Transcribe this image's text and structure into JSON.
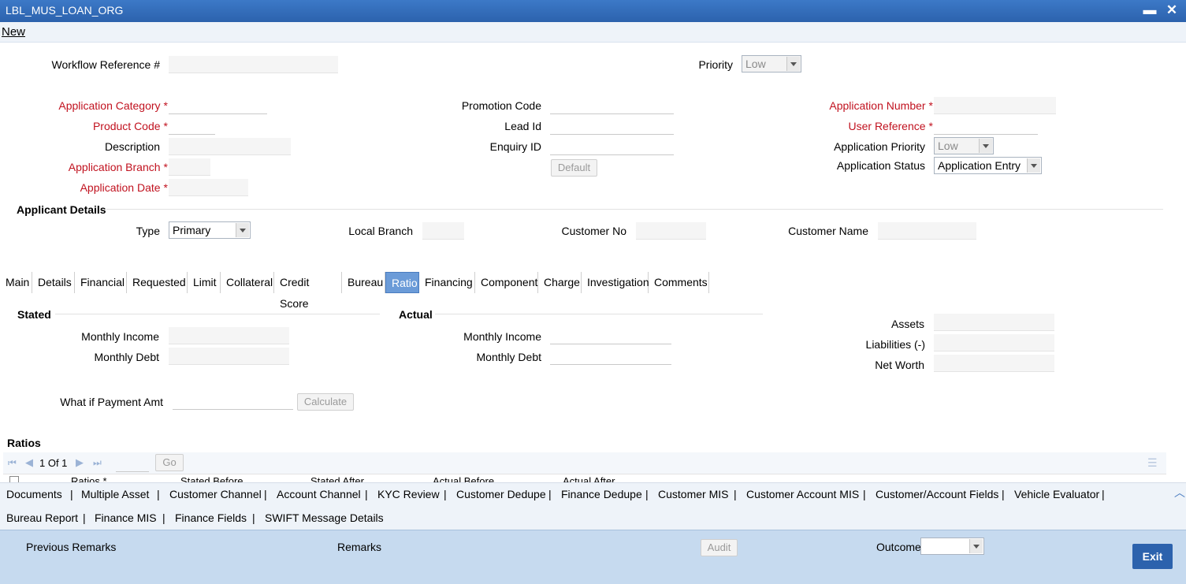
{
  "window": {
    "title": "LBL_MUS_LOAN_ORG"
  },
  "toolbar": {
    "new_label": "New"
  },
  "header": {
    "workflow_ref_label": "Workflow Reference #",
    "priority_label": "Priority",
    "priority_value": "Low"
  },
  "app": {
    "category_label": "Application Category",
    "product_code_label": "Product Code",
    "description_label": "Description",
    "branch_label": "Application Branch",
    "date_label": "Application Date",
    "promotion_code_label": "Promotion Code",
    "lead_id_label": "Lead Id",
    "enquiry_id_label": "Enquiry ID",
    "default_button": "Default",
    "app_number_label": "Application Number",
    "user_reference_label": "User Reference",
    "app_priority_label": "Application Priority",
    "app_priority_value": "Low",
    "app_status_label": "Application Status",
    "app_status_value": "Application Entry"
  },
  "applicant": {
    "section_title": "Applicant Details",
    "type_label": "Type",
    "type_value": "Primary",
    "local_branch_label": "Local Branch",
    "customer_no_label": "Customer No",
    "customer_name_label": "Customer Name"
  },
  "tabs": [
    "Main",
    "Details",
    "Financial",
    "Requested",
    "Limit",
    "Collateral",
    "Credit Score",
    "Bureau",
    "Ratio",
    "Financing",
    "Component",
    "Charge",
    "Investigation",
    "Comments"
  ],
  "active_tab": "Ratio",
  "ratio": {
    "stated_title": "Stated",
    "actual_title": "Actual",
    "monthly_income_label": "Monthly Income",
    "monthly_debt_label": "Monthly Debt",
    "assets_label": "Assets",
    "liabilities_label": "Liabilities (-)",
    "net_worth_label": "Net Worth",
    "what_if_label": "What if Payment Amt",
    "calculate_button": "Calculate",
    "ratios_title": "Ratios",
    "pager_text": "1 Of 1",
    "go_button": "Go",
    "grid_columns": [
      "Ratios *",
      "Stated Before",
      "Stated After",
      "Actual Before",
      "Actual After"
    ]
  },
  "links_row1": [
    "Documents",
    "Multiple Asset",
    "Customer Channel",
    "Account Channel",
    "KYC Review",
    "Customer Dedupe",
    "Finance Dedupe",
    "Customer MIS",
    "Customer Account MIS",
    "Customer/Account Fields",
    "Vehicle Evaluator"
  ],
  "links_row2": [
    "Bureau Report",
    "Finance MIS",
    "Finance Fields",
    "SWIFT Message Details"
  ],
  "footer": {
    "previous_remarks_label": "Previous Remarks",
    "remarks_label": "Remarks",
    "audit_button": "Audit",
    "outcome_label": "Outcome",
    "exit_button": "Exit"
  },
  "colors": {
    "titlebar": "#2c62ad",
    "required": "#c1121f",
    "active_tab": "#6b9bd8",
    "footer": "#c6daef"
  }
}
